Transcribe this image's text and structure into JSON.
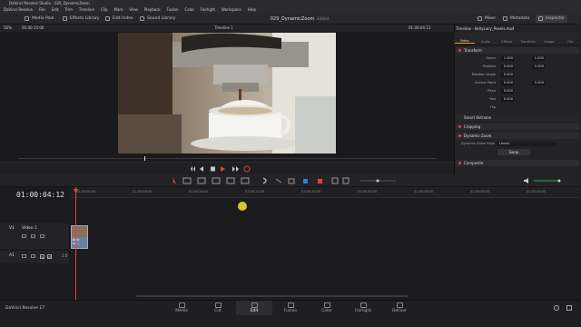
{
  "window": {
    "title": "DaVinci Resolve Studio - 029_DynamicZoom"
  },
  "menu": [
    "DaVinci Resolve",
    "File",
    "Edit",
    "Trim",
    "Timeline",
    "Clip",
    "Mark",
    "View",
    "Playback",
    "Fusion",
    "Color",
    "Fairlight",
    "Workspace",
    "Help"
  ],
  "toolbar": {
    "media_pool": "Media Pool",
    "effects_library": "Effects Library",
    "edit_index": "Edit Index",
    "sound_library": "Sound Library",
    "project_name": "029_DynamicZoom",
    "edited": "Edited",
    "mixer": "Mixer",
    "metadata": "Metadata",
    "inspector": "Inspector"
  },
  "viewer": {
    "zoom": "56%",
    "source_tc": "00:00:14:00",
    "timeline_name": "Timeline 1",
    "record_tc": "01:00:04:12"
  },
  "inspector": {
    "clip_name": "Timeline - KellyLacy_Pexels.mp4",
    "tabs": [
      "Video",
      "Audio",
      "Effects",
      "Transition",
      "Image",
      "File"
    ],
    "transform": "Transform",
    "rows": [
      {
        "label": "Zoom",
        "x": "1.000",
        "y": "1.000"
      },
      {
        "label": "Position",
        "x": "0.000",
        "y": "0.000"
      },
      {
        "label": "Rotation Angle",
        "x": "0.000",
        "y": ""
      },
      {
        "label": "Anchor Point",
        "x": "0.000",
        "y": "0.000"
      },
      {
        "label": "Pitch",
        "x": "0.000",
        "y": ""
      },
      {
        "label": "Yaw",
        "x": "0.000",
        "y": ""
      },
      {
        "label": "Flip",
        "x": "",
        "y": ""
      }
    ],
    "smart_reframe": "Smart Reframe",
    "cropping": "Cropping",
    "dynamic_zoom": "Dynamic Zoom",
    "dz_ease_label": "Dynamic Zoom Ease",
    "dz_ease_value": "Linear",
    "swap": "Swap",
    "composite": "Composite"
  },
  "timeline": {
    "timecode": "01:00:04:12",
    "ruler_ticks": [
      "01:00:00:00",
      "01:00:08:00",
      "01:00:16:00",
      "01:00:24:00",
      "01:00:32:00",
      "01:00:40:00",
      "01:00:48:00",
      "01:00:56:00",
      "01:01:04:00",
      "01:01:12:00"
    ],
    "video_track": {
      "id": "V1",
      "name": "Video 1",
      "clip_label": "Kelly La..."
    },
    "audio_track": {
      "id": "A1",
      "level": "2.0"
    }
  },
  "pages": [
    "Media",
    "Cut",
    "Edit",
    "Fusion",
    "Color",
    "Fairlight",
    "Deliver"
  ],
  "active_page": "Edit",
  "app_name": "DaVinci Resolve 17",
  "colors": {
    "accent": "#e0a020",
    "red": "#e0443a",
    "clip": "#6b7fa8"
  }
}
